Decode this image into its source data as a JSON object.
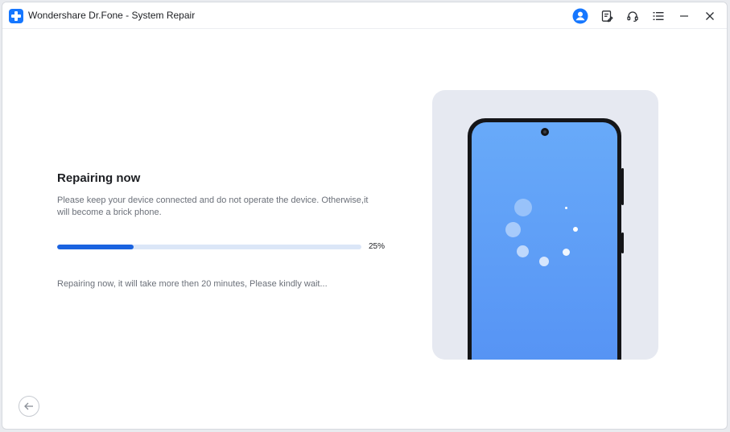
{
  "app": {
    "title": "Wondershare Dr.Fone - System Repair"
  },
  "titlebar": {
    "icons": [
      "account-icon",
      "feedback-icon",
      "support-headset-icon",
      "menu-icon",
      "minimize-icon",
      "close-icon"
    ]
  },
  "repair": {
    "heading": "Repairing now",
    "description": "Please keep your device connected and do not operate the device. Otherwise,it will become a brick phone.",
    "progress_value": 0.25,
    "progress_label": "25%",
    "status": "Repairing now, it will take more then 20 minutes, Please kindly wait..."
  },
  "colors": {
    "accent": "#1a63e0",
    "track": "#dbe6f7",
    "screen_top": "#68aaf9",
    "screen_bottom": "#5592f4",
    "illustration_bg": "#e6e9f1"
  },
  "navigation": {
    "back_icon": "back-arrow-icon"
  }
}
